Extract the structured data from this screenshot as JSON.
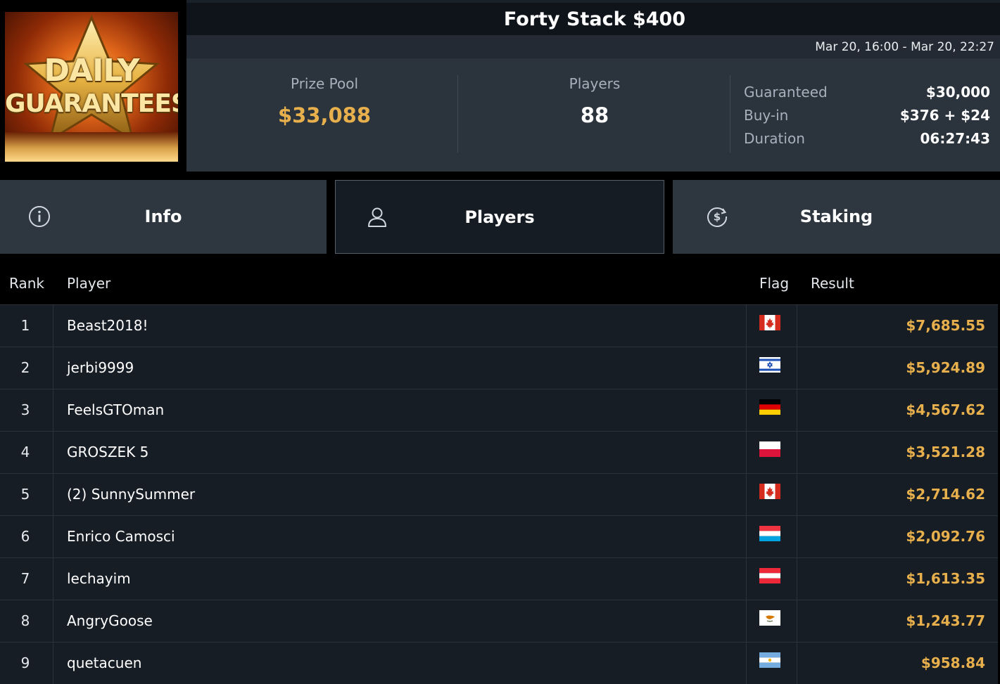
{
  "header": {
    "logo_line1": "DAILY",
    "logo_line2": "GUARANTEES",
    "title": "Forty Stack $400",
    "dates": "Mar 20, 16:00 - Mar 20, 22:27",
    "prize_pool_label": "Prize Pool",
    "prize_pool_value": "$33,088",
    "players_label": "Players",
    "players_value": "88",
    "guaranteed_label": "Guaranteed",
    "guaranteed_value": "$30,000",
    "buyin_label": "Buy-in",
    "buyin_value": "$376 + $24",
    "duration_label": "Duration",
    "duration_value": "06:27:43"
  },
  "tabs": [
    {
      "label": "Info",
      "icon": "info-icon"
    },
    {
      "label": "Players",
      "icon": "user-icon",
      "active": true
    },
    {
      "label": "Staking",
      "icon": "dollar-coin-icon"
    }
  ],
  "table": {
    "headers": {
      "rank": "Rank",
      "player": "Player",
      "flag": "Flag",
      "result": "Result"
    },
    "rows": [
      {
        "rank": "1",
        "player": "Beast2018!",
        "flag": "canada-flag",
        "result": "$7,685.55"
      },
      {
        "rank": "2",
        "player": "jerbi9999",
        "flag": "israel-flag",
        "result": "$5,924.89"
      },
      {
        "rank": "3",
        "player": "FeelsGTOman",
        "flag": "germany-flag",
        "result": "$4,567.62"
      },
      {
        "rank": "4",
        "player": "GROSZEK 5",
        "flag": "poland-flag",
        "result": "$3,521.28"
      },
      {
        "rank": "5",
        "player": "(2) SunnySummer",
        "flag": "canada-flag",
        "result": "$2,714.62"
      },
      {
        "rank": "6",
        "player": "Enrico Camosci",
        "flag": "luxembourg-flag",
        "result": "$2,092.76"
      },
      {
        "rank": "7",
        "player": "lechayim",
        "flag": "austria-flag",
        "result": "$1,613.35"
      },
      {
        "rank": "8",
        "player": "AngryGoose",
        "flag": "cyprus-flag",
        "result": "$1,243.77"
      },
      {
        "rank": "9",
        "player": "quetacuen",
        "flag": "argentina-flag",
        "result": "$958.84"
      }
    ]
  },
  "colors": {
    "accent_gold": "#e8b04c",
    "header_bg": "#2b333d",
    "row_bg": "#171d25"
  }
}
